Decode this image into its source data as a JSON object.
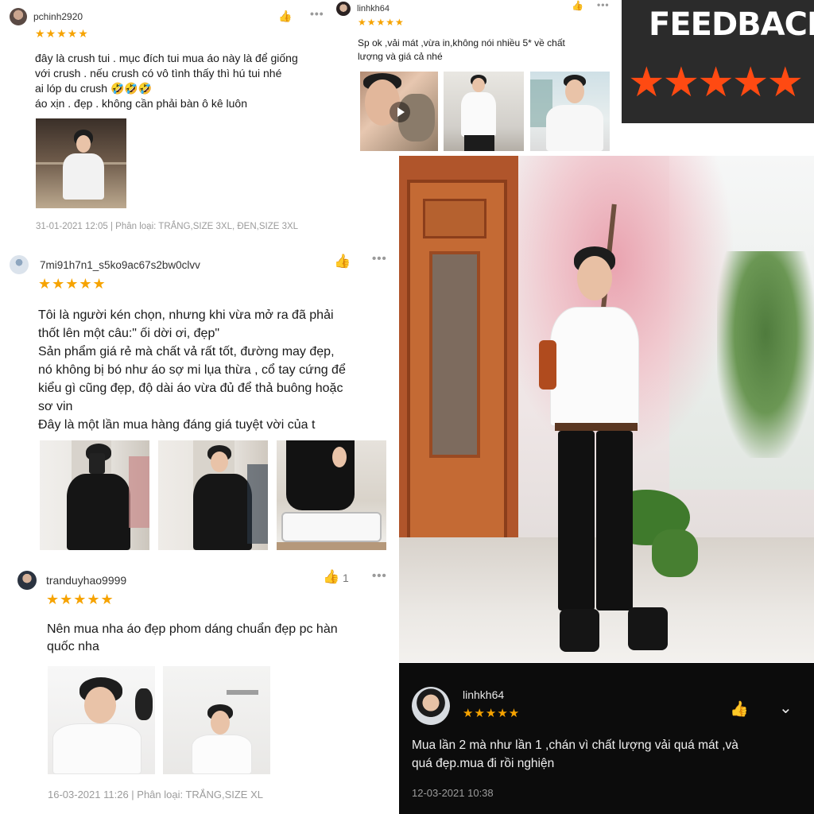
{
  "colors": {
    "star": "#f6a300",
    "like_active": "#ee4d2d",
    "banner_bg": "#2b2b2b",
    "banner_star": "#ff4a12",
    "dark_card_bg": "#0c0c0c"
  },
  "icons": [
    "thumbs-up-icon",
    "more-icon",
    "star-icon",
    "play-icon",
    "chevron-down-icon",
    "user-placeholder-icon"
  ],
  "star_rating": 5,
  "reviews": {
    "r1": {
      "username": "pchinh2920",
      "stars": "★★★★★",
      "lines": [
        "đây là crush tui . mục đích tui mua áo này là để giống",
        "với crush . nếu crush có vô tình thấy thì hú tui nhé",
        "ai lóp du crush 🤣🤣🤣",
        "áo xịn . đẹp . không cần phải bàn ô kê luôn"
      ],
      "meta": "31-01-2021 12:05 | Phân loại: TRẮNG,SIZE 3XL, ĐEN,SIZE 3XL"
    },
    "r2": {
      "username": "linhkh64",
      "stars": "★★★★★",
      "lines": [
        "Sp ok ,vải mát ,vừa in,không nói nhiều 5* về chất",
        "lượng và giá cả nhé"
      ]
    },
    "r3": {
      "username": "7mi91h7n1_s5ko9ac67s2bw0clvv",
      "stars": "★★★★★",
      "lines": [
        "Tôi là người kén chọn, nhưng khi vừa mở ra đã phải",
        "thốt lên một câu:\" ối dời ơi, đẹp\"",
        "Sản phẩm giá rẻ mà chất vả rất tốt, đường may đẹp,",
        "nó không bị bó như áo sợ mi lụa thừa , cổ tay cứng để",
        "kiểu gì cũng đẹp, độ dài áo vừa đủ để thả buông hoặc",
        "sơ vin",
        "Đây là một lần mua hàng đáng giá tuyệt vời của t"
      ]
    },
    "r4": {
      "username": "tranduyhao9999",
      "stars": "★★★★★",
      "like_count": "1",
      "lines": [
        "Nên mua nha áo đẹp phom dáng chuẩn đẹp pc hàn",
        "quốc nha"
      ],
      "meta": "16-03-2021 11:26 | Phân loại: TRẮNG,SIZE XL"
    },
    "r5": {
      "username": "linhkh64",
      "stars": "★★★★★",
      "lines": [
        "Mua lần 2 mà như lần 1 ,chán vì chất lượng vải quá mát ,và",
        "quá đẹp.mua đi rồi nghiện"
      ],
      "meta": "12-03-2021 10:38"
    }
  },
  "banner": {
    "title": "FEEDBACK",
    "stars": "★★★★★"
  }
}
